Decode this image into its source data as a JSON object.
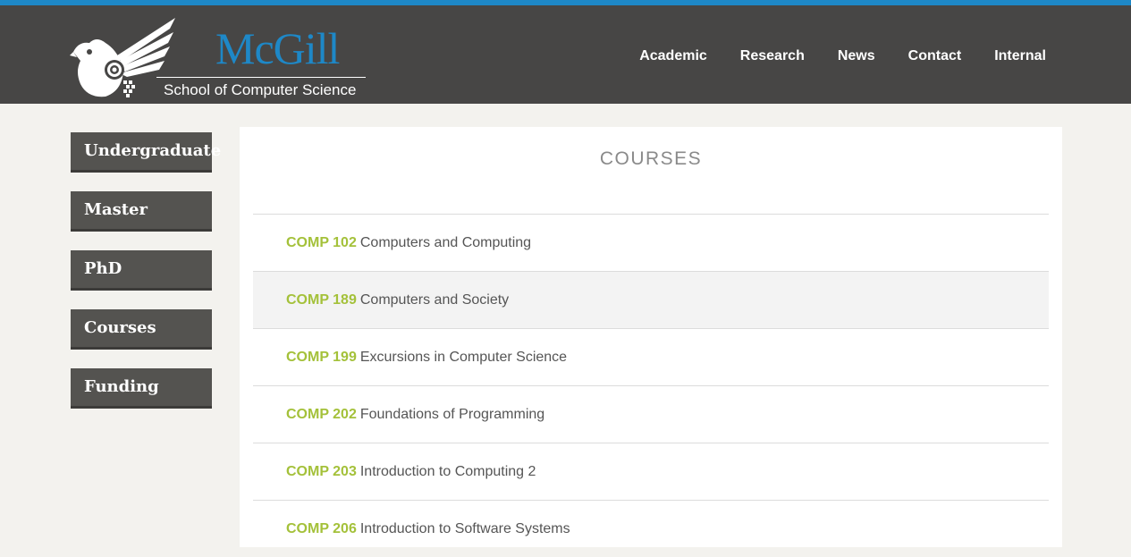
{
  "colors": {
    "accent_blue": "#1e88c7",
    "header_bg": "#474645",
    "sidebar_btn_bg": "#545350",
    "course_code_green": "#a4c13a",
    "page_bg": "#f3f2ee"
  },
  "header": {
    "brand": "McGill",
    "subtitle": "School of Computer Science",
    "logo_icon": "bird-logo-icon"
  },
  "topnav": {
    "items": [
      {
        "label": "Academic"
      },
      {
        "label": "Research"
      },
      {
        "label": "News"
      },
      {
        "label": "Contact"
      },
      {
        "label": "Internal"
      }
    ]
  },
  "sidebar": {
    "items": [
      {
        "label": "Undergraduate"
      },
      {
        "label": "Master"
      },
      {
        "label": "PhD"
      },
      {
        "label": "Courses"
      },
      {
        "label": "Funding"
      }
    ]
  },
  "main": {
    "title": "COURSES",
    "courses": [
      {
        "code": "COMP 102",
        "name": "Computers and Computing"
      },
      {
        "code": "COMP 189",
        "name": "Computers and Society"
      },
      {
        "code": "COMP 199",
        "name": "Excursions in Computer Science"
      },
      {
        "code": "COMP 202",
        "name": "Foundations of Programming"
      },
      {
        "code": "COMP 203",
        "name": "Introduction to Computing 2"
      },
      {
        "code": "COMP 206",
        "name": "Introduction to Software Systems"
      }
    ]
  }
}
